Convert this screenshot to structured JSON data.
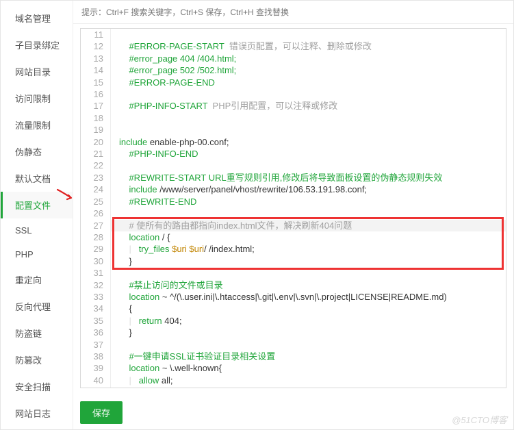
{
  "sidebar": {
    "items": [
      {
        "label": "域名管理",
        "key": "domain-manage"
      },
      {
        "label": "子目录绑定",
        "key": "subdir-bind"
      },
      {
        "label": "网站目录",
        "key": "site-dir"
      },
      {
        "label": "访问限制",
        "key": "access-limit"
      },
      {
        "label": "流量限制",
        "key": "traffic-limit"
      },
      {
        "label": "伪静态",
        "key": "rewrite"
      },
      {
        "label": "默认文档",
        "key": "default-doc"
      },
      {
        "label": "配置文件",
        "key": "config-file",
        "active": true
      },
      {
        "label": "SSL",
        "key": "ssl"
      },
      {
        "label": "PHP",
        "key": "php"
      },
      {
        "label": "重定向",
        "key": "redirect"
      },
      {
        "label": "反向代理",
        "key": "reverse-proxy"
      },
      {
        "label": "防盗链",
        "key": "antileech"
      },
      {
        "label": "防篡改",
        "key": "tamper"
      },
      {
        "label": "安全扫描",
        "key": "security-scan"
      },
      {
        "label": "网站日志",
        "key": "site-log"
      }
    ]
  },
  "hint": "提示：Ctrl+F 搜索关键字，Ctrl+S 保存，Ctrl+H 查找替换",
  "token": {
    "err_start_a": "#ERROR-PAGE-START",
    "err_start_b": "  错误页配置，可以注释、删除或修改",
    "err_404": "#error_page 404 /404.html;",
    "err_502": "#error_page 502 /502.html;",
    "err_end": "#ERROR-PAGE-END",
    "php_start_a": "#PHP-INFO-START",
    "php_start_b": "  PHP引用配置，可以注释或修改",
    "include_kw": "include",
    "include_arg": " enable-php-00.conf;",
    "php_end": "#PHP-INFO-END",
    "rw_start": "#REWRITE-START URL重写规则引用,修改后将导致面板设置的伪静态规则失效",
    "rw_inc": " /www/server/panel/vhost/rewrite/106.53.191.98.conf;",
    "rw_end": "#REWRITE-END",
    "note404": "# 使所有的路由都指向index.html文件，解决刷新404问题",
    "location_kw": "location",
    "loc_root": " / {",
    "try_kw": "try_files",
    "try_arg1": " $uri",
    "try_arg2": " $uri",
    "try_arg3": "/ /index.html;",
    "brace_close": "}",
    "forbid": "#禁止访问的文件或目录",
    "loc_deny": " ~ ^/(\\.user.ini|\\.htaccess|\\.git|\\.env|\\.svn|\\.project|LICENSE|README.md)",
    "brace_open": "{",
    "return_kw": "return",
    "return_arg": " 404;",
    "ssl_cmt": "#一键申请SSL证书验证目录相关设置",
    "loc_ssl": " ~ \\.well-known{",
    "allow_kw": "allow",
    "allow_arg": " all;"
  },
  "lines": {
    "start": 11,
    "end": 41,
    "highlight": 27,
    "redbox": {
      "from": 27,
      "to": 30
    }
  },
  "save_label": "保存",
  "watermark": "@51CTO博客"
}
